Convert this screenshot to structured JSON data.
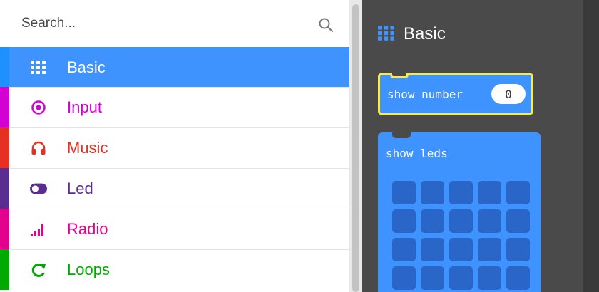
{
  "search": {
    "placeholder": "Search..."
  },
  "categories": [
    {
      "label": "Basic",
      "color": "#1e90ff",
      "icon": "grid-icon",
      "selected": true
    },
    {
      "label": "Input",
      "color": "#d400d4",
      "icon": "target-icon",
      "selected": false
    },
    {
      "label": "Music",
      "color": "#e63022",
      "icon": "headphones-icon",
      "selected": false
    },
    {
      "label": "Led",
      "color": "#5c2d91",
      "icon": "toggle-icon",
      "selected": false
    },
    {
      "label": "Radio",
      "color": "#e3008c",
      "icon": "signal-bars-icon",
      "selected": false
    },
    {
      "label": "Loops",
      "color": "#00aa00",
      "icon": "refresh-icon",
      "selected": false
    }
  ],
  "flyout": {
    "title": "Basic",
    "show_number_label": "show number",
    "show_number_value": "0",
    "show_leds_label": "show leds"
  },
  "colors": {
    "selected_bg": "#3f93ff",
    "block_blue": "#3f93ff",
    "highlight": "#ffeb3b",
    "flyout_bg": "#4a4a4a"
  }
}
